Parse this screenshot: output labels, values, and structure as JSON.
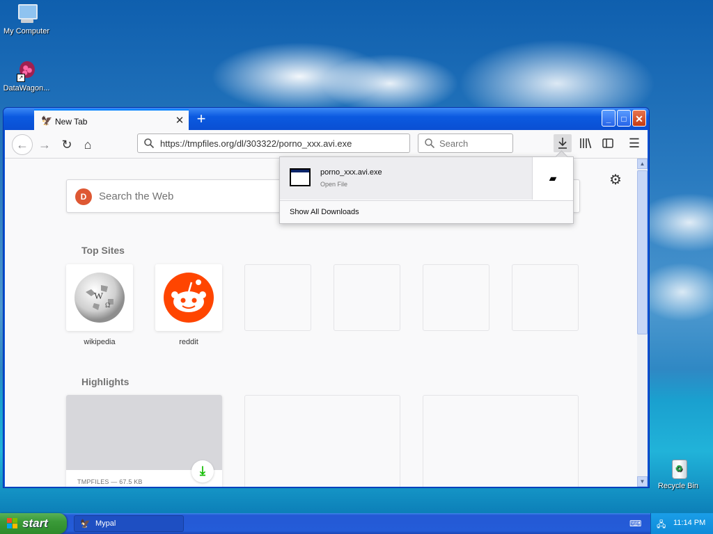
{
  "desktop": {
    "icons": [
      {
        "label": "My Computer"
      },
      {
        "label": "DataWagon..."
      },
      {
        "label": "Recycle Bin"
      }
    ]
  },
  "browser": {
    "tab": {
      "title": "New Tab",
      "close_glyph": "✕"
    },
    "new_tab_glyph": "+",
    "window_buttons": {
      "minimize": "_",
      "maximize": "□",
      "close": "✕"
    },
    "nav": {
      "back_glyph": "←",
      "forward_glyph": "→",
      "reload_glyph": "↻",
      "home_glyph": "⌂"
    },
    "url": "https://tmpfiles.org/dl/303322/porno_xxx.avi.exe",
    "search_placeholder": "Search",
    "toolbar": {
      "download_glyph": "⤓",
      "library_glyph": "|||\\",
      "sidebar_glyph": "▥",
      "menu_glyph": "☰"
    }
  },
  "newtab": {
    "web_search_placeholder": "Search the Web",
    "settings_glyph": "⚙",
    "top_sites_title": "Top Sites",
    "top_sites": [
      {
        "label": "wikipedia",
        "icon": "wikipedia-globe-icon"
      },
      {
        "label": "reddit",
        "icon": "reddit-alien-icon"
      }
    ],
    "highlights_title": "Highlights",
    "highlight_card": {
      "meta": "TMPFILES — 67.5 KB",
      "icon": "download-icon"
    }
  },
  "download_panel": {
    "filename": "porno_xxx.avi.exe",
    "status": "Open File",
    "show_all": "Show All Downloads"
  },
  "taskbar": {
    "start_label": "start",
    "task_label": "Mypal",
    "clock": "11:14 PM"
  },
  "colors": {
    "accent": "#0a84ff",
    "taskbar": "#245cd8",
    "start": "#3a9a38",
    "reddit": "#ff4500",
    "ddg": "#de5833",
    "download_green": "#12bc00"
  }
}
